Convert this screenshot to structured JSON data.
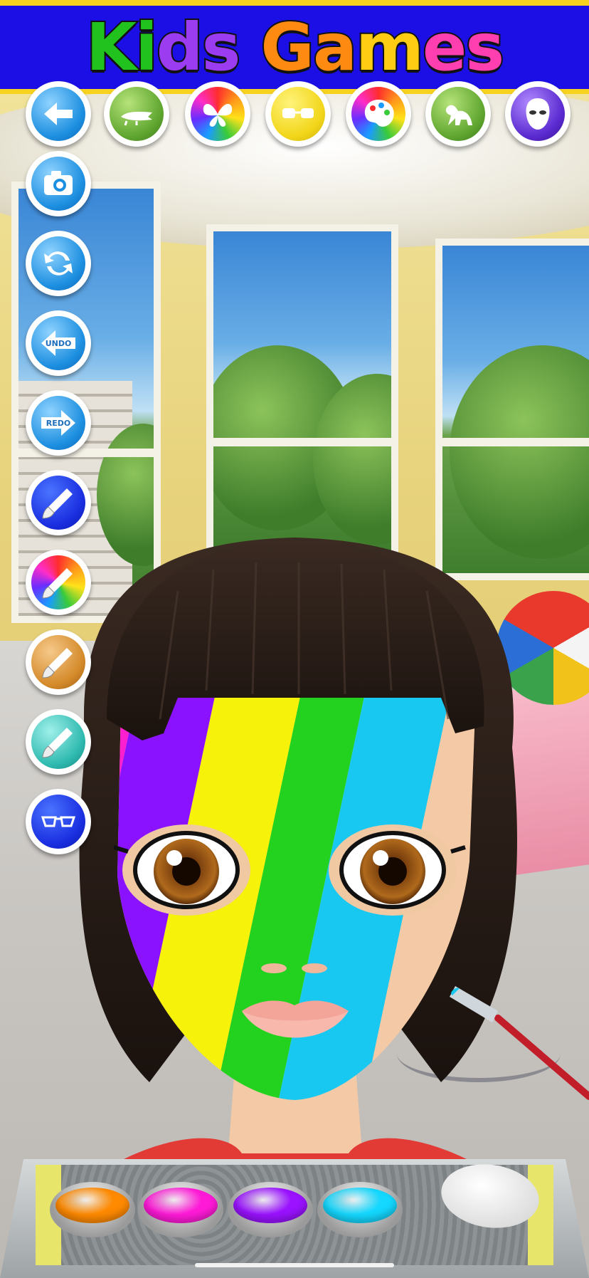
{
  "header": {
    "title_parts": [
      "K",
      "i",
      "d",
      "s",
      " ",
      "G",
      "a",
      "m",
      "e",
      "s"
    ],
    "title_colors": [
      "#21c21e",
      "#21c21e",
      "#9b3cf0",
      "#9b3cf0",
      "#ffffff",
      "#ff8a12",
      "#ff8a12",
      "#ffcc14",
      "#ff3fb0",
      "#ff3fb0"
    ],
    "brand_color": "#1b0fe6",
    "border_color": "#f7d21e"
  },
  "top_toolbar": [
    {
      "id": "back",
      "icon": "back-arrow-icon",
      "style": "glitter-blue"
    },
    {
      "id": "reptile-stickers",
      "icon": "crocodile-icon",
      "style": "glitter-green"
    },
    {
      "id": "butterfly-stickers",
      "icon": "butterfly-icon",
      "style": "glitter-rainbow"
    },
    {
      "id": "glasses-stickers",
      "icon": "sunglasses-icon",
      "style": "glitter-yellow"
    },
    {
      "id": "paint-palette",
      "icon": "paint-palette-icon",
      "style": "glitter-rainbow"
    },
    {
      "id": "dinosaur-stickers",
      "icon": "dinosaur-icon",
      "style": "glitter-green"
    },
    {
      "id": "mask-stickers",
      "icon": "mask-icon",
      "style": "glitter-purple"
    }
  ],
  "side_toolbar": [
    {
      "id": "camera",
      "icon": "camera-icon",
      "style": "glitter-blue",
      "label": ""
    },
    {
      "id": "reset",
      "icon": "refresh-icon",
      "style": "glitter-blue",
      "label": ""
    },
    {
      "id": "undo",
      "icon": "undo-arrow-icon",
      "style": "glitter-blue",
      "label": "UNDO"
    },
    {
      "id": "redo",
      "icon": "redo-arrow-icon",
      "style": "glitter-blue",
      "label": "REDO"
    },
    {
      "id": "brush-solid",
      "icon": "paintbrush-icon",
      "style": "solid-blue",
      "label": ""
    },
    {
      "id": "brush-rainbow",
      "icon": "paintbrush-icon",
      "style": "glitter-rainbow",
      "label": ""
    },
    {
      "id": "brush-gold-glitter",
      "icon": "paintbrush-icon",
      "style": "glitter-gold",
      "label": ""
    },
    {
      "id": "brush-teal-glitter",
      "icon": "paintbrush-icon",
      "style": "glitter-teal",
      "label": ""
    },
    {
      "id": "glasses",
      "icon": "glasses-icon",
      "style": "solid-blue",
      "label": ""
    }
  ],
  "face_paint_stripes": [
    "#1a5fe0",
    "#ff1fcf",
    "#8a12ff",
    "#f6f20a",
    "#22d21e",
    "#18c8f0"
  ],
  "palette": [
    {
      "id": "orange",
      "color": "#ff8a00"
    },
    {
      "id": "magenta",
      "color": "#ff1ad8"
    },
    {
      "id": "purple",
      "color": "#9a12ff"
    },
    {
      "id": "cyan",
      "color": "#14d8ff"
    },
    {
      "id": "white",
      "color": "#ffffff"
    }
  ]
}
